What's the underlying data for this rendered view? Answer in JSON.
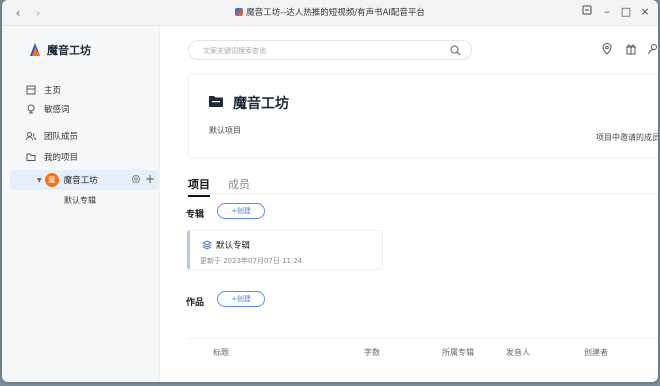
{
  "window": {
    "title": "魔音工坊--达人热推的短视频/有声书AI配音平台",
    "back_label": "‹",
    "forward_label": "›"
  },
  "sidebar": {
    "brand": "魔音工坊",
    "menu": [
      {
        "label": "主页",
        "icon": "home-icon"
      },
      {
        "label": "敏感词",
        "icon": "sensitive-word-icon"
      },
      {
        "label": "团队成员",
        "icon": "team-icon"
      },
      {
        "label": "我的项目",
        "icon": "folder-icon"
      }
    ],
    "project": {
      "avatar": "魔",
      "name": "魔音工坊",
      "plus": "+"
    },
    "sub_item": "默认专辑"
  },
  "search": {
    "placeholder": "文案关键词搜索查询"
  },
  "project_card": {
    "title": "魔音工坊",
    "description": "默认项目",
    "invite_text": "项目中邀请的成员"
  },
  "tabs": [
    {
      "label": "项目",
      "active": true
    },
    {
      "label": "成员",
      "active": false
    }
  ],
  "albums_section": {
    "label": "专辑",
    "create_label": "+创建"
  },
  "album": {
    "name": "默认专辑",
    "updated": "更新于 2023年07月07日 11:24"
  },
  "works_section": {
    "label": "作品",
    "create_label": "+创建"
  },
  "table": {
    "columns": [
      "标题",
      "字数",
      "所属专辑",
      "发音人",
      "创建者"
    ]
  },
  "colors": {
    "accent": "#4b7bd8",
    "avatar": "#f97316",
    "selected_bg": "#e6eefc"
  }
}
